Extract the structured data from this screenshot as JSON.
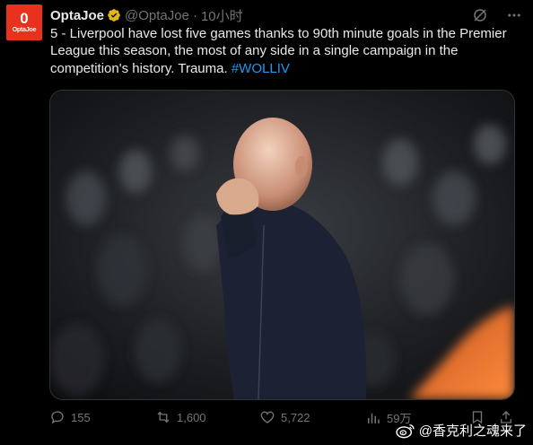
{
  "author": {
    "display_name": "OptaJoe",
    "handle": "@OptaJoe",
    "separator": "·",
    "timestamp": "10小时",
    "avatar_glyph": "0",
    "avatar_text": "OptaJoe",
    "verified_color": "#e2b719"
  },
  "tweet": {
    "text": "5 - Liverpool have lost five games thanks to 90th minute goals in the Premier League this season, the most of any side in a single campaign in the competition's history. Trauma.",
    "hashtag": "#WOLLIV"
  },
  "actions": {
    "replies": "155",
    "retweets": "1,600",
    "likes": "5,722",
    "views": "59万"
  },
  "watermark": {
    "text": "@香克利之魂来了"
  },
  "colors": {
    "background": "#000000",
    "text": "#e7e9ea",
    "muted": "#71767b",
    "link": "#1d9bf0"
  }
}
